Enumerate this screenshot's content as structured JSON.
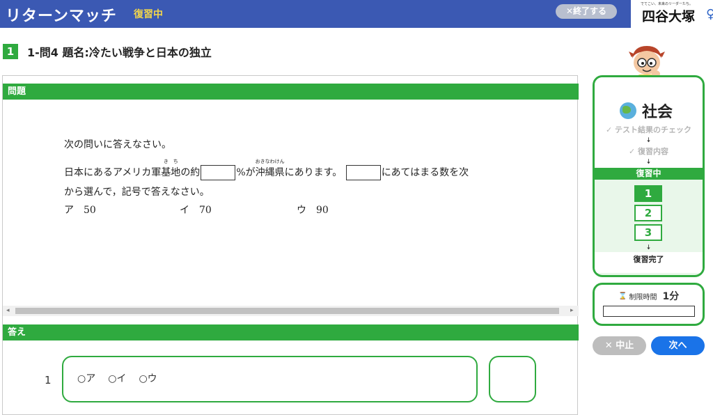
{
  "header": {
    "title": "リターンマッチ",
    "status": "復習中",
    "end_button": "✕終了する",
    "logo_tagline": "でてこい、未来のリーダーたち。",
    "logo_name": "四谷大塚"
  },
  "question": {
    "number": "1",
    "title": "1-問4 題名:冷たい戦争と日本の独立",
    "section_label": "問題",
    "instruction": "次の問いに答えなさい。",
    "text_part1": "日本にあるアメリカ軍",
    "ruby_word1": "基地",
    "ruby_reading1": "き　ち",
    "text_part2": "の約",
    "text_part3": "%が",
    "ruby_word2": "沖縄県",
    "ruby_reading2": "おきなわけん",
    "text_part4": "にあります。",
    "text_part5": "にあてはまる数を次",
    "text_line2": "から選んで，記号で答えなさい。",
    "choices": [
      {
        "label": "ア",
        "value": "50"
      },
      {
        "label": "イ",
        "value": "70"
      },
      {
        "label": "ウ",
        "value": "90"
      }
    ]
  },
  "answer": {
    "section_label": "答え",
    "row_number": "1",
    "options": [
      "○ア",
      "○イ",
      "○ウ"
    ]
  },
  "sidebar": {
    "subject": "社会",
    "steps": [
      "✓ テスト結果のチェック",
      "✓ 復習内容"
    ],
    "active": "復習中",
    "rounds": [
      "1",
      "2",
      "3"
    ],
    "complete": "復習完了"
  },
  "timer": {
    "label": "制限時間",
    "value": "1分"
  },
  "buttons": {
    "stop": "✕ 中止",
    "next": "次へ"
  }
}
